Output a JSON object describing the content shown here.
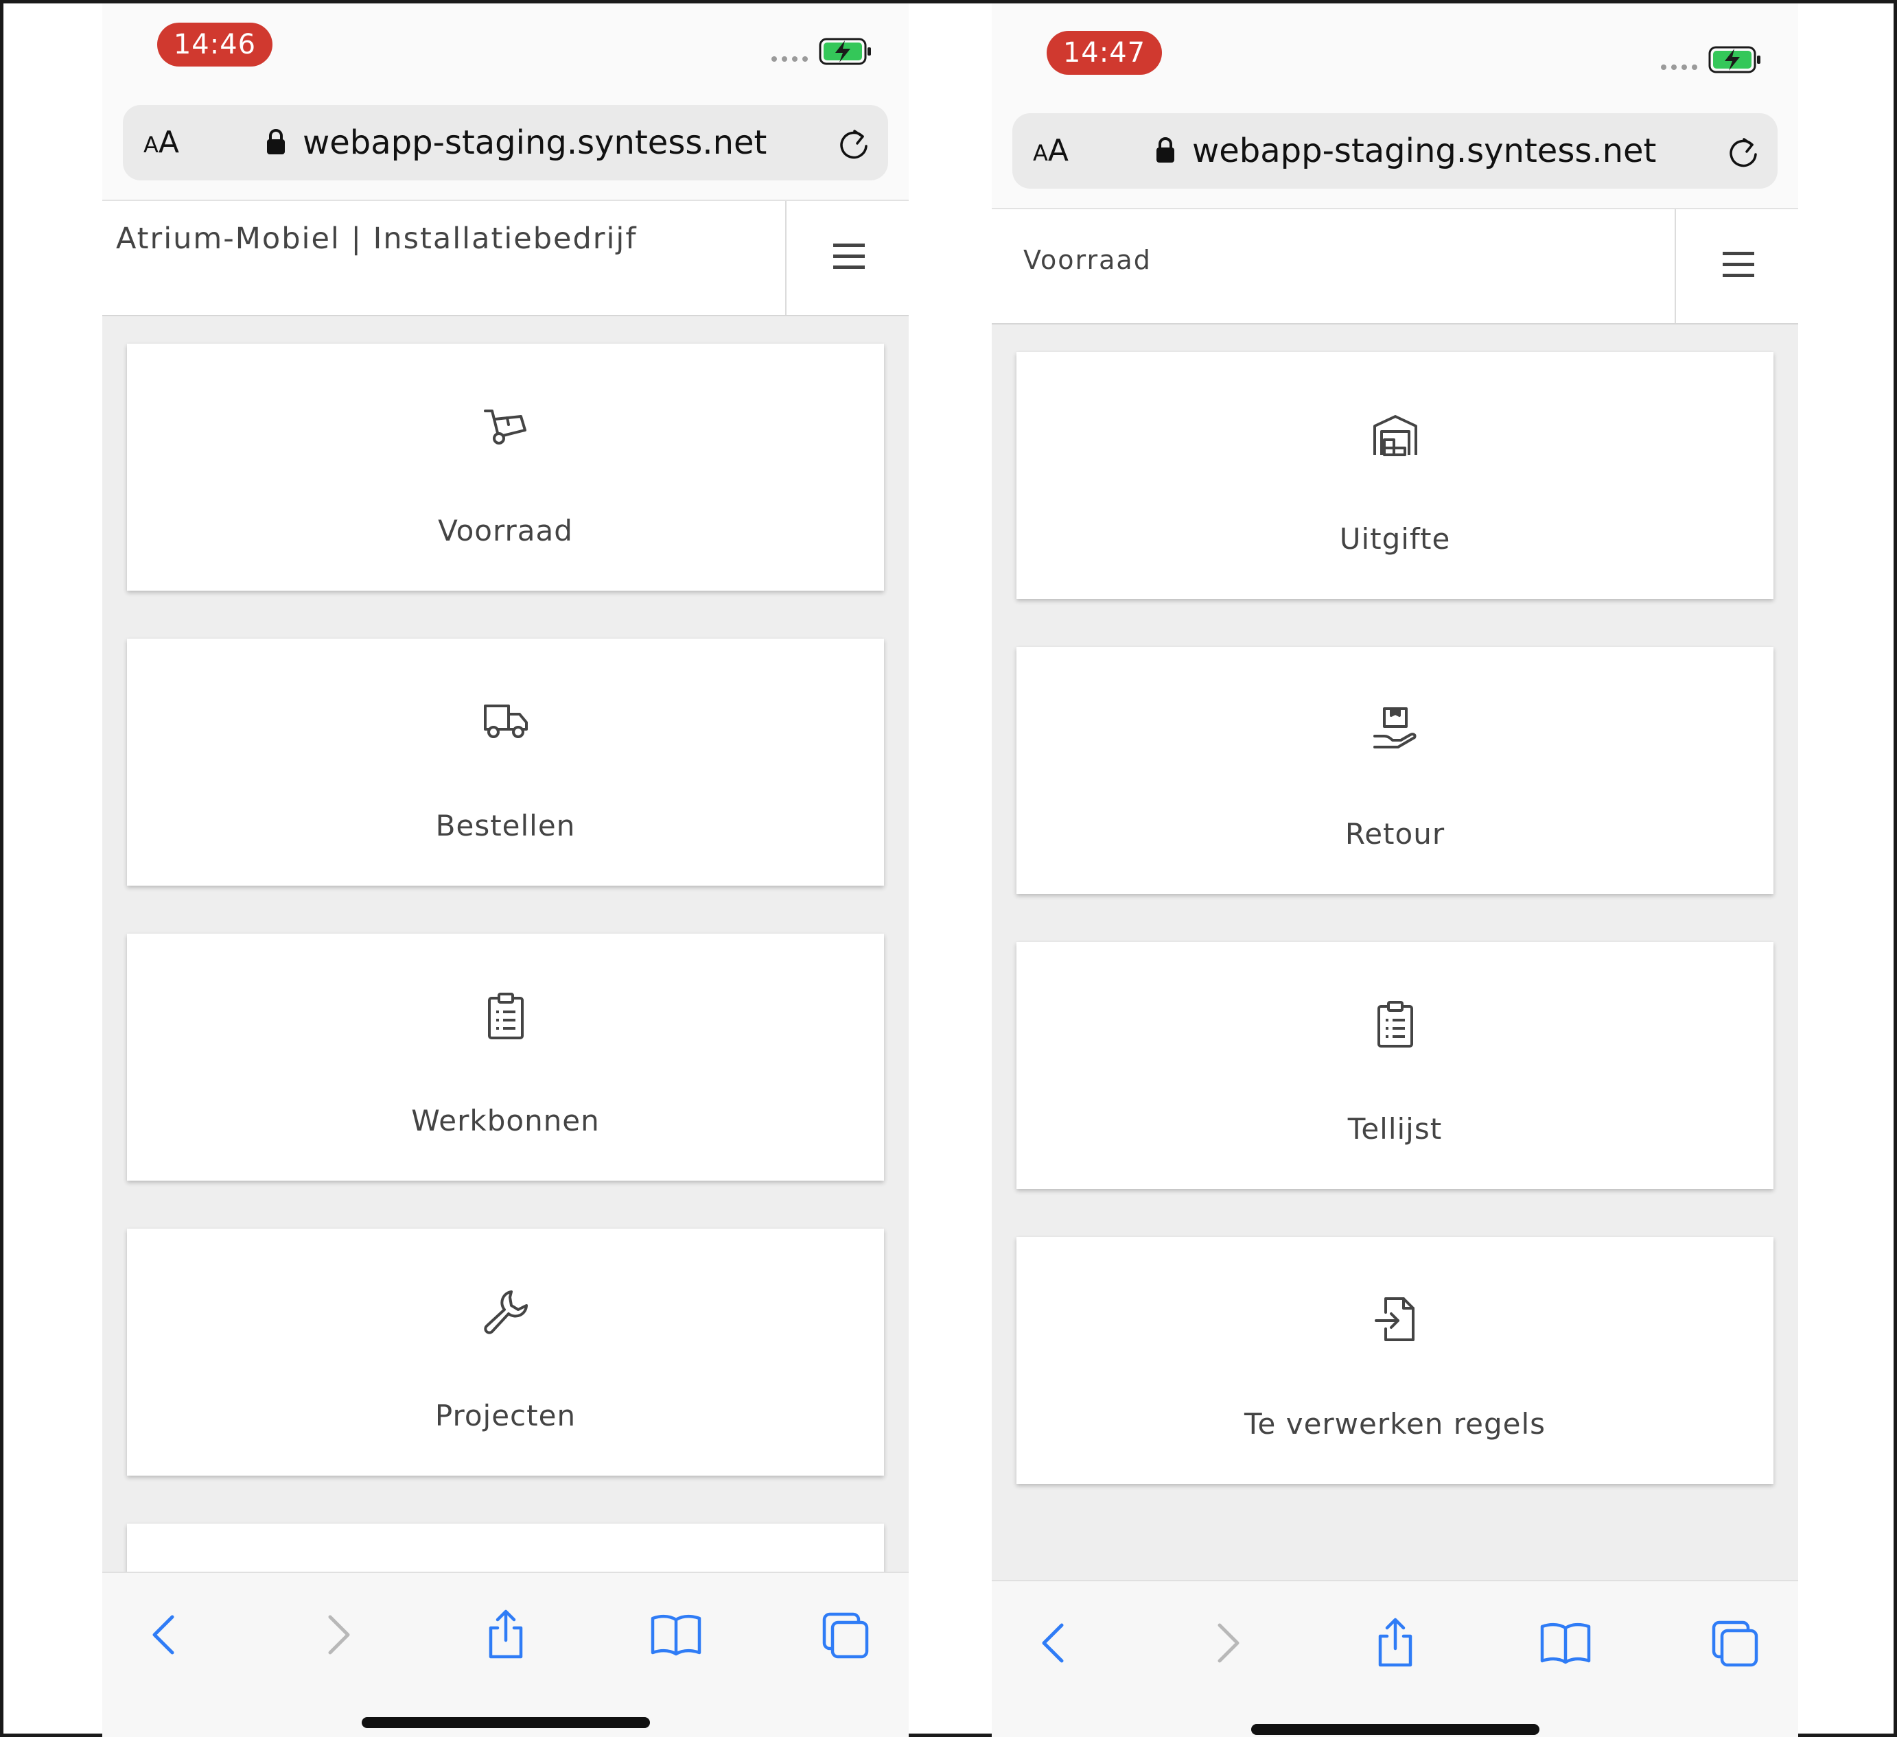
{
  "left_phone": {
    "status": {
      "time": "14:46"
    },
    "browser": {
      "text_size_small": "A",
      "text_size_large": "A",
      "url": "webapp-staging.syntess.net"
    },
    "header": {
      "title": "Atrium-Mobiel | Installatiebedrijf"
    },
    "tiles": [
      {
        "label": "Voorraad",
        "icon": "hand-truck-icon"
      },
      {
        "label": "Bestellen",
        "icon": "truck-icon"
      },
      {
        "label": "Werkbonnen",
        "icon": "clipboard-list-icon"
      },
      {
        "label": "Projecten",
        "icon": "wrench-icon"
      }
    ]
  },
  "right_phone": {
    "status": {
      "time": "14:47"
    },
    "browser": {
      "text_size_small": "A",
      "text_size_large": "A",
      "url": "webapp-staging.syntess.net"
    },
    "header": {
      "title": "Voorraad"
    },
    "tiles": [
      {
        "label": "Uitgifte",
        "icon": "warehouse-icon"
      },
      {
        "label": "Retour",
        "icon": "hand-box-icon"
      },
      {
        "label": "Tellijst",
        "icon": "clipboard-list-icon"
      },
      {
        "label": "Te verwerken regels",
        "icon": "file-import-icon"
      }
    ]
  },
  "colors": {
    "time_pill": "#d0392f",
    "accent_blue": "#2f7cf6",
    "battery_green": "#34c759",
    "tile_text": "#444444",
    "content_bg": "#eeeeee"
  }
}
